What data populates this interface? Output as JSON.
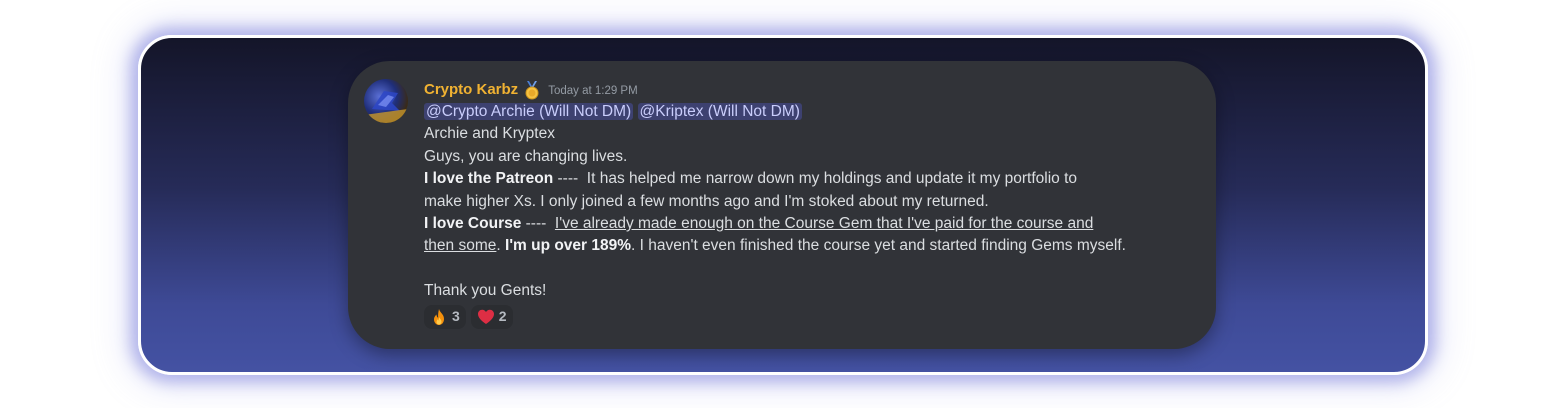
{
  "message": {
    "author": "Crypto Karbz",
    "timestamp": "Today at 1:29 PM",
    "mentions": [
      "@Crypto Archie (Will Not DM)",
      "@Kriptex (Will Not DM)"
    ],
    "line1": "Archie and Kryptex",
    "line2": "Guys, you are changing lives.",
    "patreon_bold": "I love the Patreon",
    "patreon_dashes": " ----  ",
    "patreon_text": "It has helped me narrow down my holdings and update it my portfolio to",
    "patreon_text_cont": "make higher Xs. I only joined a few months ago and I'm stoked about my returned.",
    "course_bold": "I love Course",
    "course_dashes": " ----  ",
    "course_underlined_1": "I've already made enough on the Course Gem that I've paid for the course and",
    "course_underlined_2": "then some",
    "course_period": ". ",
    "course_bold_2": "I'm up over 189%",
    "course_tail": ". I haven't even finished the course yet and started finding Gems myself.",
    "closing": "Thank you Gents!"
  },
  "reactions": [
    {
      "icon": "fire-emoji",
      "count": "3"
    },
    {
      "icon": "heart-emoji",
      "count": "2"
    }
  ],
  "colors": {
    "username": "#f0b232",
    "card": "#313338",
    "mention_bg": "#5865f2"
  }
}
